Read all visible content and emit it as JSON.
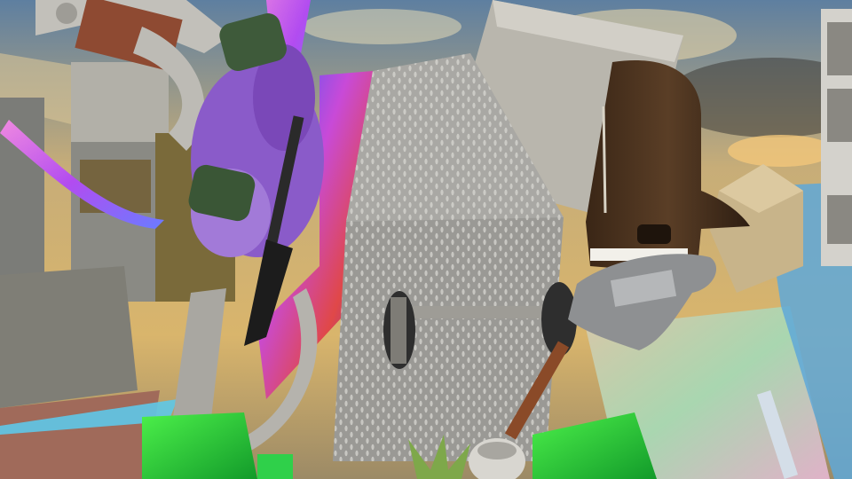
{
  "scene": {
    "palette": {
      "sky_top": "#6f8fa8",
      "sky_mid": "#c9b07a",
      "sky_warm": "#e6c27a",
      "cloud_dark": "#3a3a38",
      "concrete": "#b9b6ad",
      "diamond_plate": "#9d9c98",
      "piano_wood": "#4a3220",
      "rainbow_pink": "#e05ad0",
      "rainbow_blue": "#4a6cff",
      "neon_green": "#27d63a",
      "fern_purple": "#8a5bc9",
      "crate_wood": "#c8b48a",
      "guitar_silver": "#8e9092"
    },
    "objects": [
      {
        "name": "sky-backdrop",
        "icon": "sky"
      },
      {
        "name": "stone-column-left",
        "icon": "pillar"
      },
      {
        "name": "grey-ring-arch",
        "icon": "arch"
      },
      {
        "name": "rainbow-ribbon",
        "icon": "ribbon"
      },
      {
        "name": "purple-fern-bush",
        "icon": "fern"
      },
      {
        "name": "green-barrels",
        "icon": "barrel"
      },
      {
        "name": "colorful-panel-center",
        "icon": "panel"
      },
      {
        "name": "diamond-plate-block",
        "icon": "metal-plate"
      },
      {
        "name": "concrete-slab-tilted",
        "icon": "slab"
      },
      {
        "name": "dumbbell-bar",
        "icon": "dumbbell"
      },
      {
        "name": "grand-piano-upright",
        "icon": "piano"
      },
      {
        "name": "electric-guitar-silver",
        "icon": "guitar"
      },
      {
        "name": "electric-guitar-black",
        "icon": "guitar"
      },
      {
        "name": "wooden-crate",
        "icon": "crate"
      },
      {
        "name": "bookshelf-right",
        "icon": "shelf"
      },
      {
        "name": "pastel-cube-right",
        "icon": "cube"
      },
      {
        "name": "neon-green-cube",
        "icon": "cube"
      },
      {
        "name": "grey-stone-block-left",
        "icon": "block"
      },
      {
        "name": "aloe-plant",
        "icon": "plant"
      },
      {
        "name": "desk-lamp-shade",
        "icon": "lamp"
      }
    ]
  }
}
